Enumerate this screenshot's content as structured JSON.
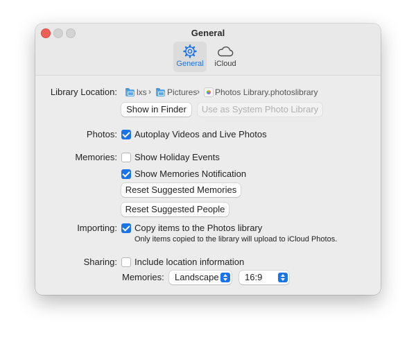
{
  "window": {
    "title": "General",
    "tabs": [
      {
        "label": "General",
        "icon": "gear-icon",
        "selected": true
      },
      {
        "label": "iCloud",
        "icon": "cloud-icon",
        "selected": false
      }
    ]
  },
  "library": {
    "label": "Library Location:",
    "path": [
      {
        "name": "lxs",
        "icon": "folder-icon"
      },
      {
        "name": "Pictures",
        "icon": "folder-icon"
      },
      {
        "name": "Photos Library.photoslibrary",
        "icon": "photos-library-icon"
      }
    ],
    "separator": "›",
    "show_in_finder": "Show in Finder",
    "use_as_system": "Use as System Photo Library"
  },
  "photos": {
    "label": "Photos:",
    "autoplay": {
      "label": "Autoplay Videos and Live Photos",
      "checked": true
    }
  },
  "memories": {
    "label": "Memories:",
    "holiday": {
      "label": "Show Holiday Events",
      "checked": false
    },
    "notification": {
      "label": "Show Memories Notification",
      "checked": true
    },
    "reset_memories": "Reset Suggested Memories",
    "reset_people": "Reset Suggested People"
  },
  "importing": {
    "label": "Importing:",
    "copy": {
      "label": "Copy items to the Photos library",
      "checked": true
    },
    "note": "Only items copied to the library will upload to iCloud Photos."
  },
  "sharing": {
    "label": "Sharing:",
    "location": {
      "label": "Include location information",
      "checked": false
    },
    "memories_label": "Memories:",
    "orientation": "Landscape",
    "aspect": "16:9"
  },
  "colors": {
    "accent": "#1a73e8",
    "close": "#ee5f57"
  }
}
